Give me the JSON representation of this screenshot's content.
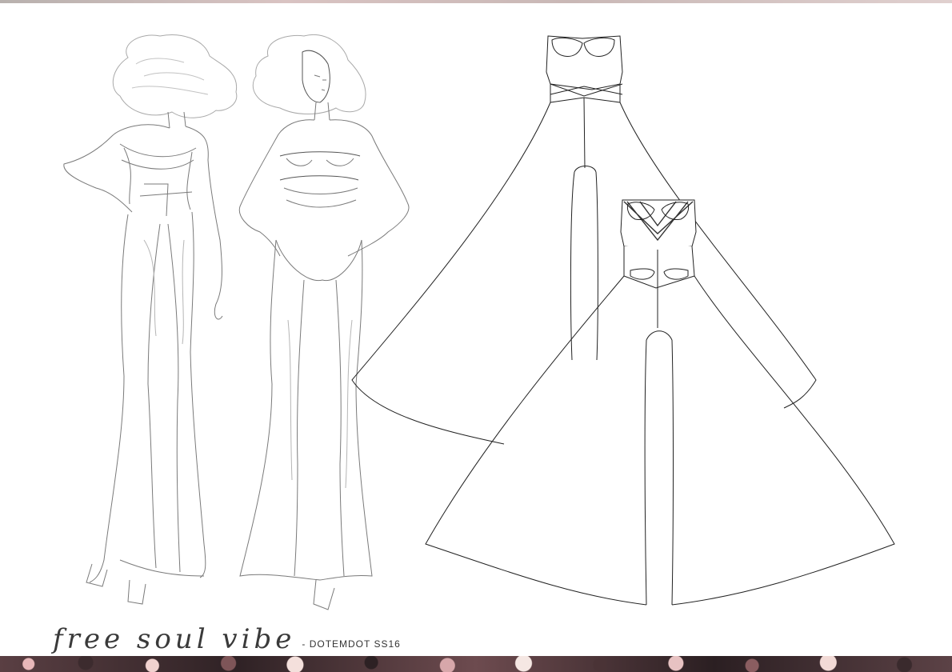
{
  "caption": {
    "script_text": "free soul vibe",
    "label_text": "- DOTEMDOT SS16"
  },
  "colors": {
    "background": "#ffffff",
    "pencil": "#6e6e6e",
    "line": "#222222"
  }
}
